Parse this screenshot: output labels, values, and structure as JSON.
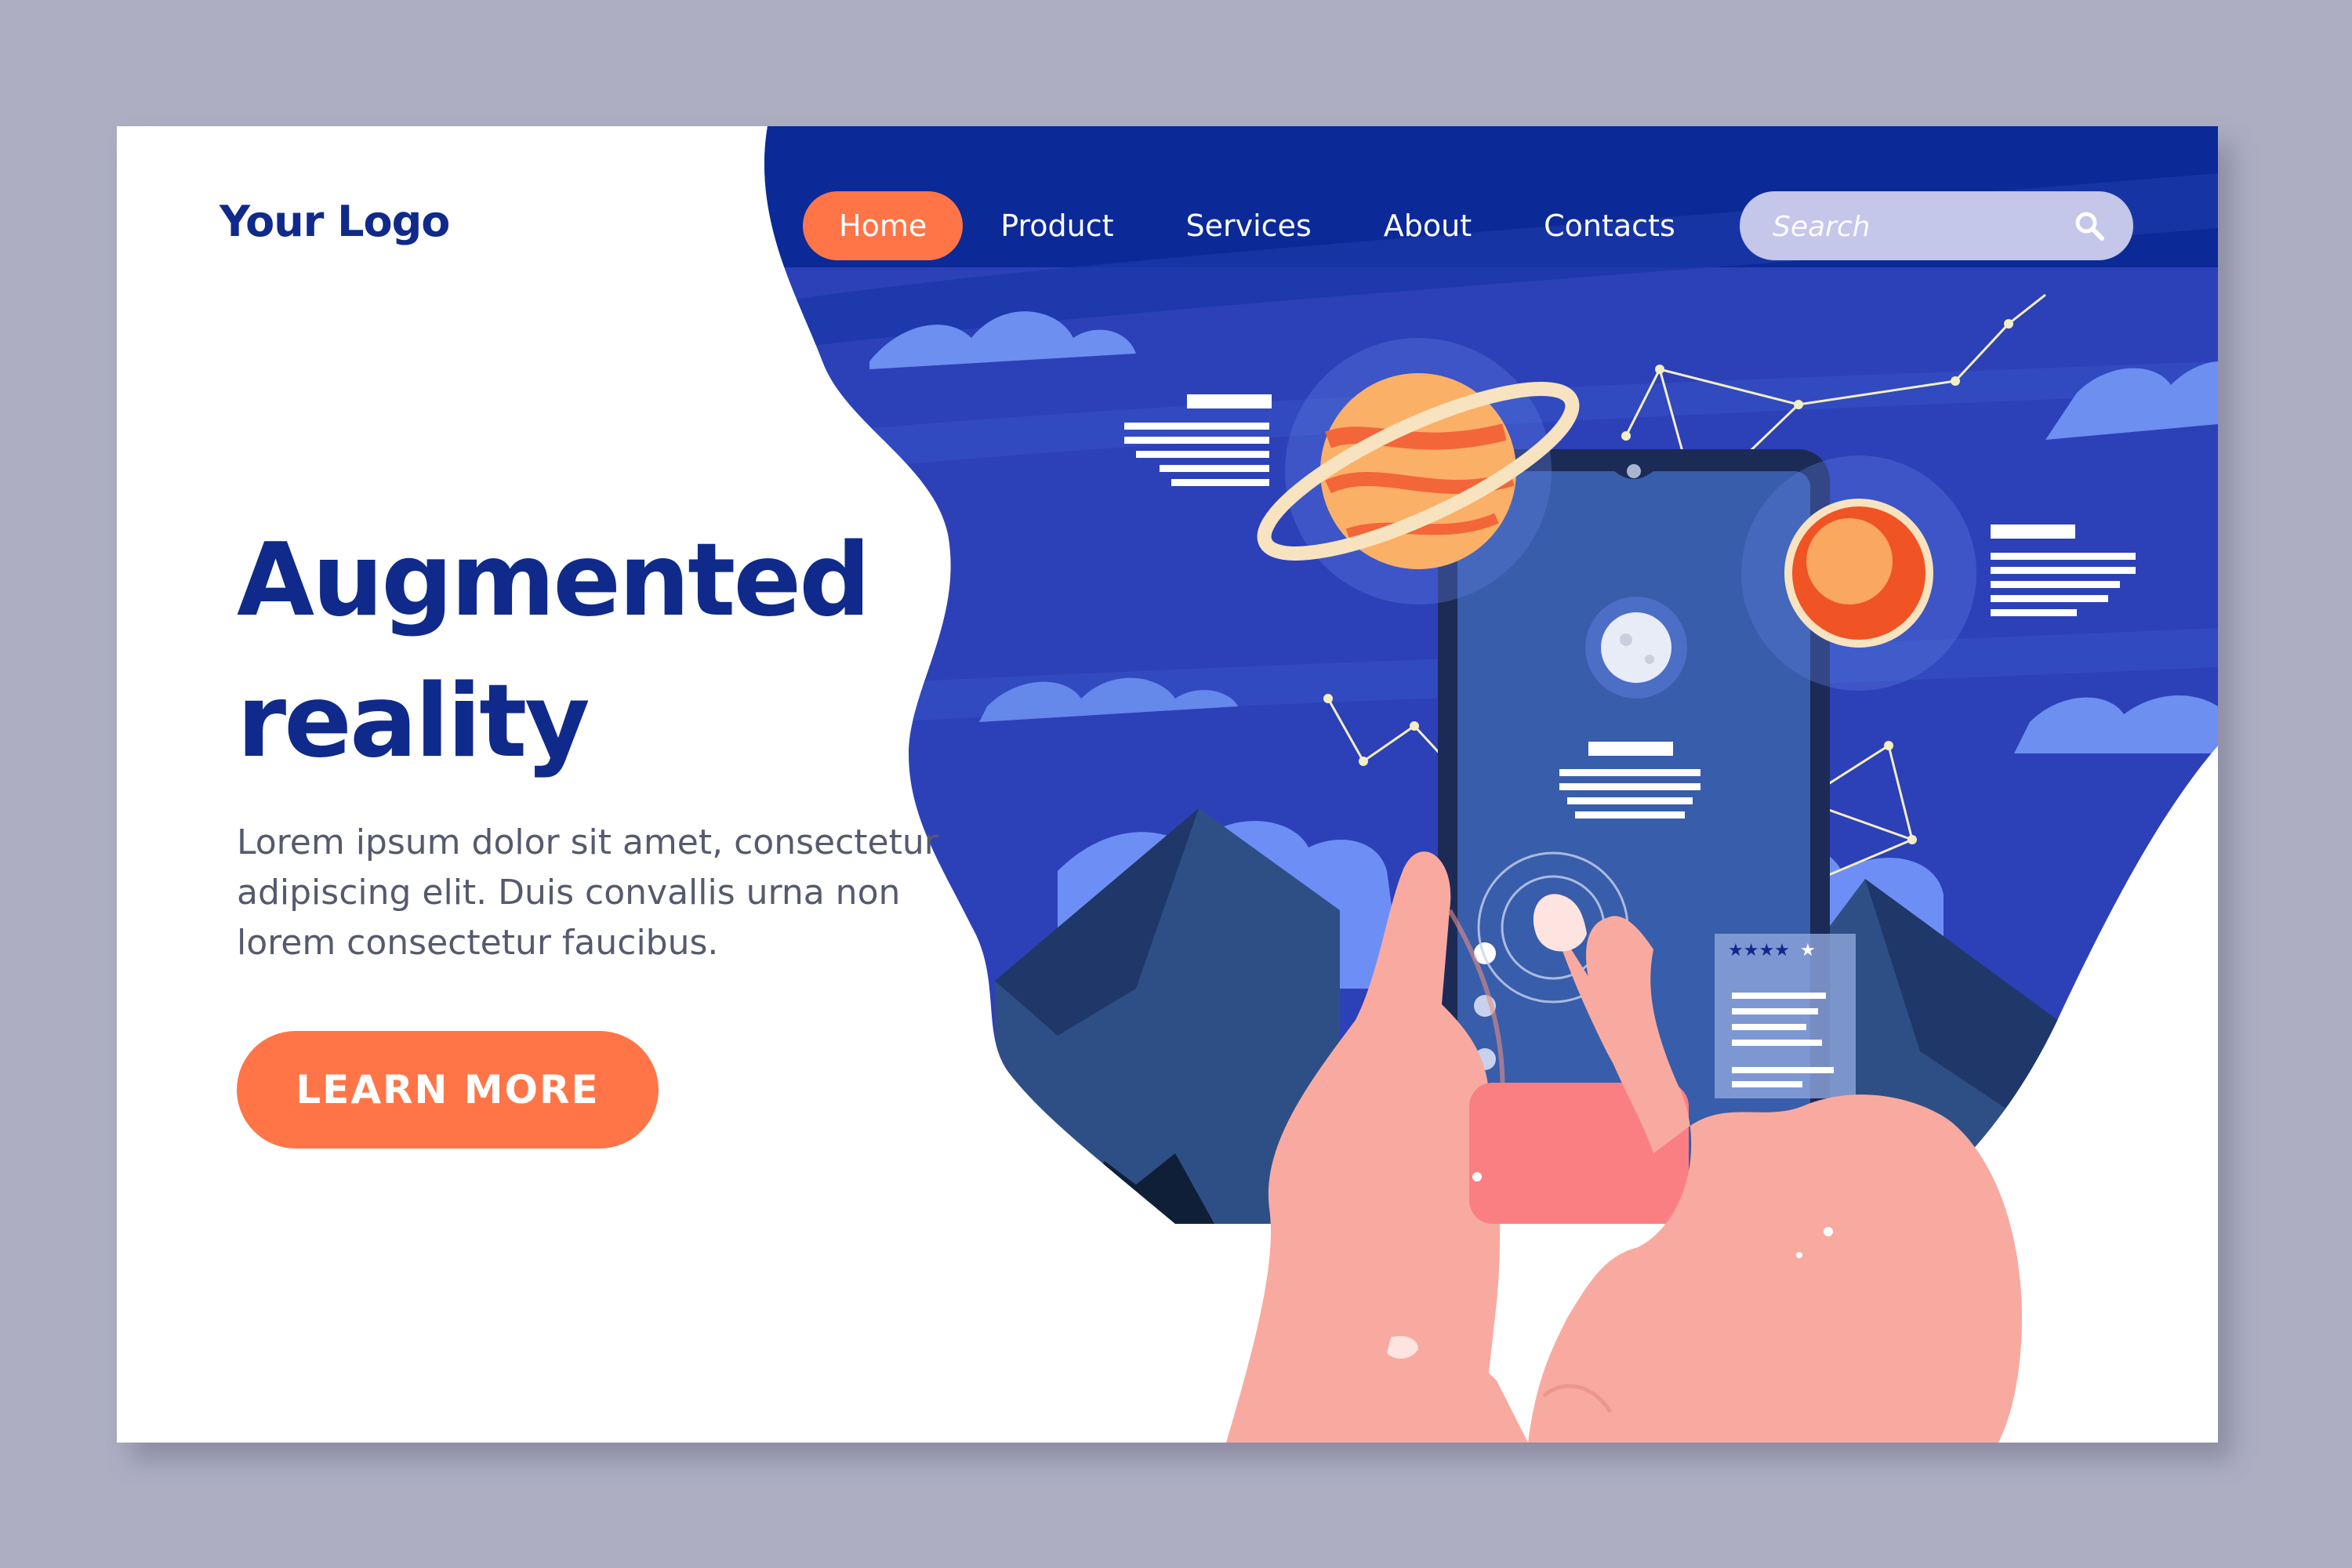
{
  "header": {
    "logo_text": "Your Logo",
    "nav": [
      "Home",
      "Product",
      "Services",
      "About",
      "Contacts"
    ],
    "active_nav": "Home",
    "search_placeholder": "Search"
  },
  "hero": {
    "title_line1": "Augmented",
    "title_line2": "reality",
    "body": "Lorem ipsum dolor sit amet, consectetur adipiscing elit. Duis convallis urna non lorem consectetur faucibus.",
    "cta_label": "LEARN MORE"
  },
  "illustration": {
    "rating_stars": 4,
    "rating_max": 5
  },
  "colors": {
    "primary": "#0f2a8a",
    "accent": "#ff7548",
    "night_sky": "#2c40b8",
    "background": "#adaec2"
  }
}
